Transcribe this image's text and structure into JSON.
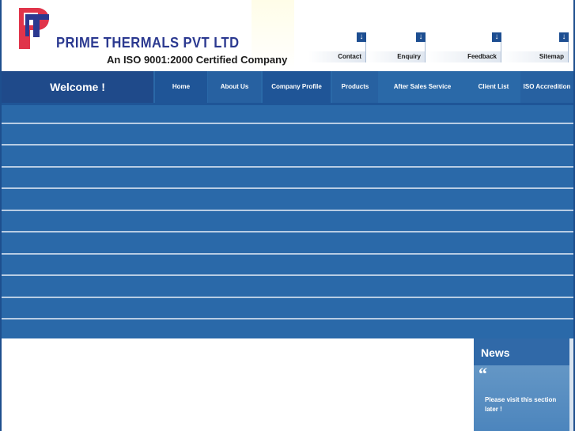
{
  "header": {
    "company_name": "PRIME THERMALS PVT LTD",
    "tagline": "An ISO 9001:2000 Certified Company",
    "top_links": [
      {
        "label": "Contact",
        "icon": "down-arrow-icon"
      },
      {
        "label": "Enquiry",
        "icon": "down-arrow-icon"
      },
      {
        "label": "Feedback",
        "icon": "down-arrow-icon"
      },
      {
        "label": "Sitemap",
        "icon": "down-arrow-icon"
      }
    ]
  },
  "nav": {
    "welcome": "Welcome !",
    "items": [
      "Home",
      "About Us",
      "Company Profile",
      "Products",
      "After Sales Service",
      "Client List",
      "ISO Accredition"
    ]
  },
  "news": {
    "title": "News",
    "message": "Please visit this section later !"
  },
  "colors": {
    "brand_blue": "#2b3990",
    "logo_red": "#e0344a",
    "nav_blue": "#2a69a8",
    "welcome_blue": "#1f4a8a"
  }
}
